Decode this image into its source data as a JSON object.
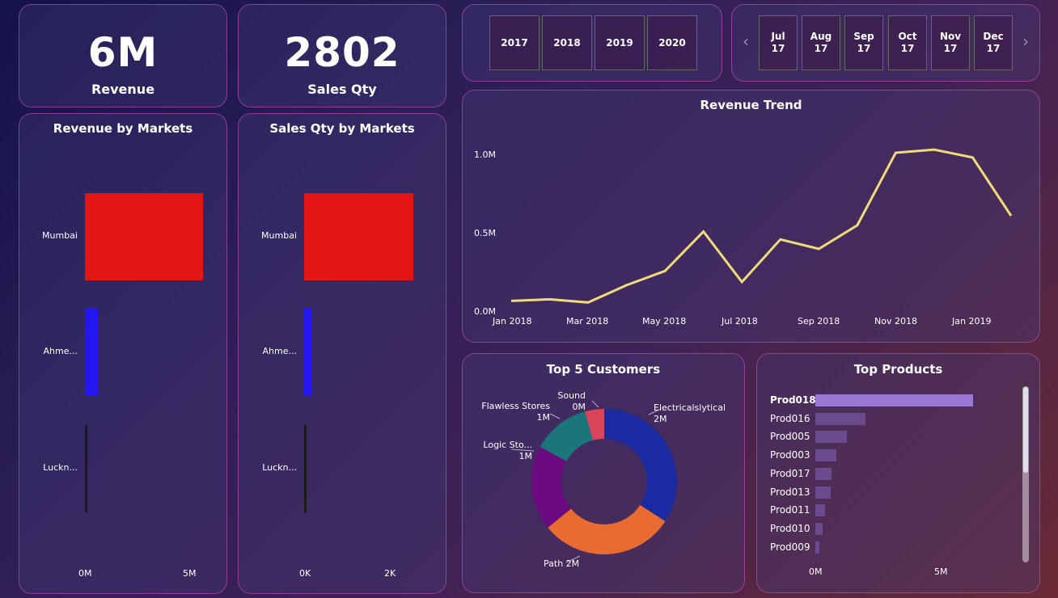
{
  "kpis": {
    "revenue": {
      "value": "6M",
      "label": "Revenue"
    },
    "sales_qty": {
      "value": "2802",
      "label": "Sales Qty"
    }
  },
  "revenue_by_markets": {
    "title": "Revenue by Markets",
    "bars": [
      {
        "label": "Mumbai",
        "value": 4.8,
        "color": "#e31616"
      },
      {
        "label": "Ahme...",
        "value": 0.5,
        "color": "#2517f2"
      },
      {
        "label": "Luckn...",
        "value": 0.1,
        "color": "#1a1a1a"
      }
    ],
    "ticks": [
      "0M",
      "5M"
    ]
  },
  "sales_qty_by_markets": {
    "title": "Sales Qty by Markets",
    "bars": [
      {
        "label": "Mumbai",
        "value": 2500,
        "color": "#e31616"
      },
      {
        "label": "Ahme...",
        "value": 170,
        "color": "#2517f2"
      },
      {
        "label": "Luckn...",
        "value": 50,
        "color": "#1a1a1a"
      }
    ],
    "ticks": [
      "0K",
      "2K"
    ]
  },
  "year_slicer": {
    "years": [
      "2017",
      "2018",
      "2019",
      "2020"
    ]
  },
  "month_slicer": {
    "months": [
      {
        "month": "Jul",
        "year": "17"
      },
      {
        "month": "Aug",
        "year": "17"
      },
      {
        "month": "Sep",
        "year": "17"
      },
      {
        "month": "Oct",
        "year": "17"
      },
      {
        "month": "Nov",
        "year": "17"
      },
      {
        "month": "Dec",
        "year": "17"
      }
    ],
    "prev_icon": "chevron-left-icon",
    "next_icon": "chevron-right-icon"
  },
  "revenue_trend": {
    "title": "Revenue Trend",
    "x_ticks": [
      "Jan 2018",
      "Mar 2018",
      "May 2018",
      "Jul 2018",
      "Sep 2018",
      "Nov 2018",
      "Jan 2019"
    ],
    "y_ticks": [
      "0.0M",
      "0.5M",
      "1.0M"
    ]
  },
  "top_customers": {
    "title": "Top 5 Customers",
    "segments": [
      {
        "name": "Electricalslytical",
        "value": "2M",
        "color": "#1a2aa3"
      },
      {
        "name": "Path",
        "value": "2M",
        "color": "#e86b32"
      },
      {
        "name": "Logic Sto...",
        "value": "1M",
        "color": "#6c0a7f"
      },
      {
        "name": "Flawless Stores",
        "value": "1M",
        "color": "#1a767a"
      },
      {
        "name": "Sound",
        "value": "0M",
        "color": "#d9465a"
      }
    ]
  },
  "top_products": {
    "title": "Top Products",
    "items": [
      {
        "name": "Prod018",
        "value": 6.3,
        "highlight": true
      },
      {
        "name": "Prod016",
        "value": 2.0
      },
      {
        "name": "Prod005",
        "value": 1.25
      },
      {
        "name": "Prod003",
        "value": 0.85
      },
      {
        "name": "Prod017",
        "value": 0.65
      },
      {
        "name": "Prod013",
        "value": 0.6
      },
      {
        "name": "Prod011",
        "value": 0.4
      },
      {
        "name": "Prod010",
        "value": 0.3
      },
      {
        "name": "Prod009",
        "value": 0.15
      }
    ],
    "ticks": [
      "0M",
      "5M"
    ],
    "bar_color": "#6c4a8e",
    "highlight_color": "#9b77d6"
  },
  "chart_data": [
    {
      "type": "bar",
      "title": "Revenue by Markets",
      "categories": [
        "Mumbai",
        "Ahme...",
        "Luckn..."
      ],
      "values": [
        4.8,
        0.5,
        0.1
      ],
      "unit": "M",
      "xlim": [
        0,
        6
      ]
    },
    {
      "type": "bar",
      "title": "Sales Qty by Markets",
      "categories": [
        "Mumbai",
        "Ahme...",
        "Luckn..."
      ],
      "values": [
        2500,
        170,
        50
      ],
      "xlim": [
        0,
        3000
      ]
    },
    {
      "type": "line",
      "title": "Revenue Trend",
      "x": [
        "Jan 2018",
        "Feb 2018",
        "Mar 2018",
        "Apr 2018",
        "May 2018",
        "Jun 2018",
        "Jul 2018",
        "Aug 2018",
        "Sep 2018",
        "Oct 2018",
        "Nov 2018",
        "Dec 2018",
        "Jan 2019",
        "Feb 2019"
      ],
      "values": [
        0.07,
        0.08,
        0.06,
        0.17,
        0.26,
        0.51,
        0.19,
        0.46,
        0.4,
        0.55,
        1.01,
        1.03,
        0.98,
        0.61
      ],
      "unit": "M",
      "ylim": [
        0,
        1.2
      ],
      "color": "#f0da7a"
    },
    {
      "type": "pie",
      "title": "Top 5 Customers",
      "categories": [
        "Electricalslytical",
        "Path",
        "Logic Sto...",
        "Flawless Stores",
        "Sound"
      ],
      "values": [
        2.0,
        1.75,
        1.1,
        0.75,
        0.25
      ],
      "unit": "M"
    },
    {
      "type": "bar",
      "title": "Top Products",
      "categories": [
        "Prod018",
        "Prod016",
        "Prod005",
        "Prod003",
        "Prod017",
        "Prod013",
        "Prod011",
        "Prod010",
        "Prod009"
      ],
      "values": [
        6.3,
        2.0,
        1.25,
        0.85,
        0.65,
        0.6,
        0.4,
        0.3,
        0.15
      ],
      "unit": "M",
      "xlim": [
        0,
        8
      ]
    }
  ]
}
